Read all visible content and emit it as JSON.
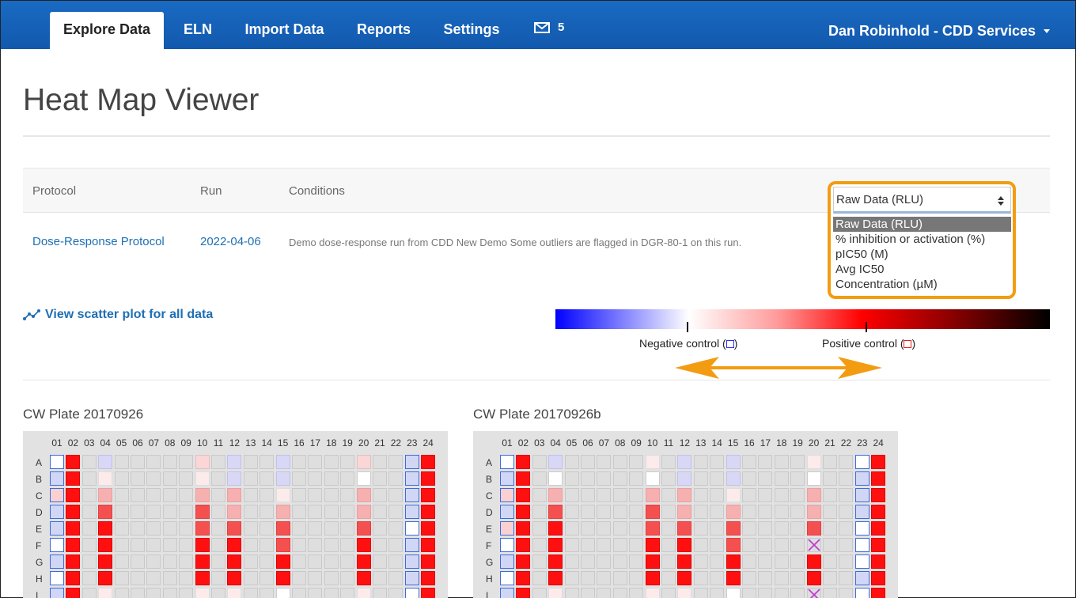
{
  "nav": {
    "tabs": [
      {
        "label": "Explore Data",
        "active": true
      },
      {
        "label": "ELN",
        "active": false
      },
      {
        "label": "Import Data",
        "active": false
      },
      {
        "label": "Reports",
        "active": false
      },
      {
        "label": "Settings",
        "active": false
      }
    ],
    "mail_count": "5",
    "user": "Dan Robinhold - CDD Services"
  },
  "page_title": "Heat Map Viewer",
  "protocol_table": {
    "headers": {
      "protocol": "Protocol",
      "run": "Run",
      "conditions": "Conditions"
    },
    "row": {
      "protocol": "Dose-Response Protocol",
      "run": "2022-04-06",
      "conditions": "Demo dose-response run from CDD New Demo Some outliers are flagged in DGR-80-1 on this run."
    }
  },
  "readout_select": {
    "selected": "Raw Data (RLU)",
    "options": [
      "Raw Data (RLU)",
      "% inhibition or activation (%)",
      "pIC50 (M)",
      "Avg IC50",
      "Concentration (µM)"
    ],
    "highlight_color": "#f39c12"
  },
  "scatter_link": "View scatter plot for all data",
  "colorbar": {
    "negative_label": "Negative control (",
    "positive_label": "Positive control (",
    "close": ")",
    "colors": [
      "#0000ff",
      "#ffffff",
      "#ff0000",
      "#000000"
    ]
  },
  "plates": [
    {
      "title": "CW Plate 20170926",
      "columns": [
        "01",
        "02",
        "03",
        "04",
        "05",
        "06",
        "07",
        "08",
        "09",
        "10",
        "11",
        "12",
        "13",
        "14",
        "15",
        "16",
        "17",
        "18",
        "19",
        "20",
        "21",
        "22",
        "23",
        "24"
      ],
      "rows": [
        "A",
        "B",
        "C",
        "D",
        "E",
        "F",
        "G",
        "H",
        "I"
      ],
      "wells": [
        [
          "nw",
          "R",
          "g",
          "lb",
          "g",
          "g",
          "g",
          "g",
          "g",
          "pp",
          "g",
          "lb",
          "g",
          "g",
          "lb",
          "g",
          "g",
          "g",
          "g",
          "pp",
          "g",
          "g",
          "nb",
          "R"
        ],
        [
          "nb",
          "R",
          "g",
          "vl",
          "g",
          "g",
          "g",
          "g",
          "g",
          "vl",
          "g",
          "lb",
          "g",
          "g",
          "lb",
          "g",
          "g",
          "g",
          "g",
          "w",
          "g",
          "g",
          "nb",
          "R"
        ],
        [
          "np",
          "R",
          "g",
          "lp",
          "g",
          "g",
          "g",
          "g",
          "g",
          "lp",
          "g",
          "lp",
          "g",
          "g",
          "vl",
          "g",
          "g",
          "g",
          "g",
          "lp",
          "g",
          "g",
          "nb",
          "R"
        ],
        [
          "nb",
          "R",
          "g",
          "mr",
          "g",
          "g",
          "g",
          "g",
          "g",
          "mr",
          "g",
          "lp",
          "g",
          "g",
          "lp",
          "g",
          "g",
          "g",
          "g",
          "lp",
          "g",
          "g",
          "nb",
          "R"
        ],
        [
          "nb",
          "R",
          "g",
          "R",
          "g",
          "g",
          "g",
          "g",
          "g",
          "mr",
          "g",
          "mr",
          "g",
          "g",
          "mr",
          "g",
          "g",
          "g",
          "g",
          "mr",
          "g",
          "g",
          "nw",
          "R"
        ],
        [
          "nw",
          "R",
          "g",
          "R",
          "g",
          "g",
          "g",
          "g",
          "g",
          "R",
          "g",
          "R",
          "g",
          "g",
          "mr",
          "g",
          "g",
          "g",
          "g",
          "R",
          "g",
          "g",
          "nb",
          "R"
        ],
        [
          "nb",
          "R",
          "g",
          "R",
          "g",
          "g",
          "g",
          "g",
          "g",
          "R",
          "g",
          "R",
          "g",
          "g",
          "R",
          "g",
          "g",
          "g",
          "g",
          "R",
          "g",
          "g",
          "nb",
          "R"
        ],
        [
          "nw",
          "R",
          "g",
          "R",
          "g",
          "g",
          "g",
          "g",
          "g",
          "R",
          "g",
          "R",
          "g",
          "g",
          "R",
          "g",
          "g",
          "g",
          "g",
          "R",
          "g",
          "g",
          "nb",
          "R"
        ],
        [
          "nb",
          "R",
          "g",
          "vl",
          "g",
          "g",
          "g",
          "g",
          "g",
          "vl",
          "g",
          "vl",
          "g",
          "g",
          "w",
          "g",
          "g",
          "g",
          "g",
          "vl",
          "g",
          "g",
          "nw",
          "R"
        ]
      ]
    },
    {
      "title": "CW Plate 20170926b",
      "columns": [
        "01",
        "02",
        "03",
        "04",
        "05",
        "06",
        "07",
        "08",
        "09",
        "10",
        "11",
        "12",
        "13",
        "14",
        "15",
        "16",
        "17",
        "18",
        "19",
        "20",
        "21",
        "22",
        "23",
        "24"
      ],
      "rows": [
        "A",
        "B",
        "C",
        "D",
        "E",
        "F",
        "G",
        "H",
        "I"
      ],
      "wells": [
        [
          "nw",
          "R",
          "g",
          "lb",
          "g",
          "g",
          "g",
          "g",
          "g",
          "vl",
          "g",
          "lb",
          "g",
          "g",
          "lb",
          "g",
          "g",
          "g",
          "g",
          "vl",
          "g",
          "g",
          "nw",
          "R"
        ],
        [
          "nb",
          "R",
          "g",
          "w",
          "g",
          "g",
          "g",
          "g",
          "g",
          "w",
          "g",
          "lb",
          "g",
          "g",
          "lb",
          "g",
          "g",
          "g",
          "g",
          "w",
          "g",
          "g",
          "nb",
          "R"
        ],
        [
          "np",
          "R",
          "g",
          "lp",
          "g",
          "g",
          "g",
          "g",
          "g",
          "lp",
          "g",
          "lp",
          "g",
          "g",
          "vl",
          "g",
          "g",
          "g",
          "g",
          "lp",
          "g",
          "g",
          "nb",
          "R"
        ],
        [
          "nb",
          "R",
          "g",
          "mr",
          "g",
          "g",
          "g",
          "g",
          "g",
          "mr",
          "g",
          "lp",
          "g",
          "g",
          "lp",
          "g",
          "g",
          "g",
          "g",
          "lp",
          "g",
          "g",
          "nb",
          "R"
        ],
        [
          "np",
          "R",
          "g",
          "R",
          "g",
          "g",
          "g",
          "g",
          "g",
          "mr",
          "g",
          "mr",
          "g",
          "g",
          "mr",
          "g",
          "g",
          "g",
          "g",
          "mr",
          "g",
          "g",
          "nw",
          "R"
        ],
        [
          "nw",
          "R",
          "g",
          "R",
          "g",
          "g",
          "g",
          "g",
          "g",
          "R",
          "g",
          "R",
          "g",
          "g",
          "mr",
          "g",
          "g",
          "g",
          "g",
          "X",
          "g",
          "g",
          "nw",
          "R"
        ],
        [
          "nb",
          "R",
          "g",
          "R",
          "g",
          "g",
          "g",
          "g",
          "g",
          "R",
          "g",
          "R",
          "g",
          "g",
          "R",
          "g",
          "g",
          "g",
          "g",
          "R",
          "g",
          "g",
          "nw",
          "R"
        ],
        [
          "nw",
          "R",
          "g",
          "R",
          "g",
          "g",
          "g",
          "g",
          "g",
          "R",
          "g",
          "R",
          "g",
          "g",
          "R",
          "g",
          "g",
          "g",
          "g",
          "R",
          "g",
          "g",
          "nb",
          "R"
        ],
        [
          "nb",
          "R",
          "g",
          "vl",
          "g",
          "g",
          "g",
          "g",
          "g",
          "vl",
          "g",
          "vl",
          "g",
          "g",
          "w",
          "g",
          "g",
          "g",
          "g",
          "X",
          "g",
          "g",
          "nw",
          "R"
        ]
      ]
    }
  ]
}
